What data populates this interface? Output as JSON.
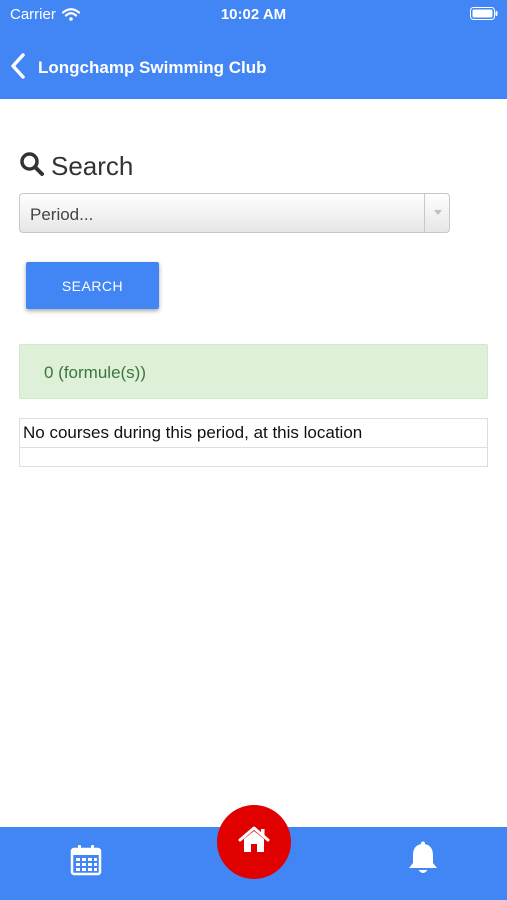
{
  "status_bar": {
    "carrier": "Carrier",
    "time": "10:02 AM"
  },
  "navbar": {
    "title": "Longchamp Swimming Club",
    "back_icon": "chevron-left-icon"
  },
  "search": {
    "heading": "Search",
    "heading_icon": "search-icon",
    "period_select_value": "Period...",
    "button_label": "SEARCH"
  },
  "results": {
    "count_label": "0 (formule(s))",
    "table_rows": [
      "No courses during this period, at this location",
      ""
    ]
  },
  "bottom_nav": {
    "left_icon": "calendar-icon",
    "center_icon": "home-icon",
    "right_icon": "bell-icon"
  },
  "colors": {
    "primary": "#4285f4",
    "home_button": "#e00000",
    "success_bg": "#dff0d8",
    "success_text": "#3c763d"
  }
}
